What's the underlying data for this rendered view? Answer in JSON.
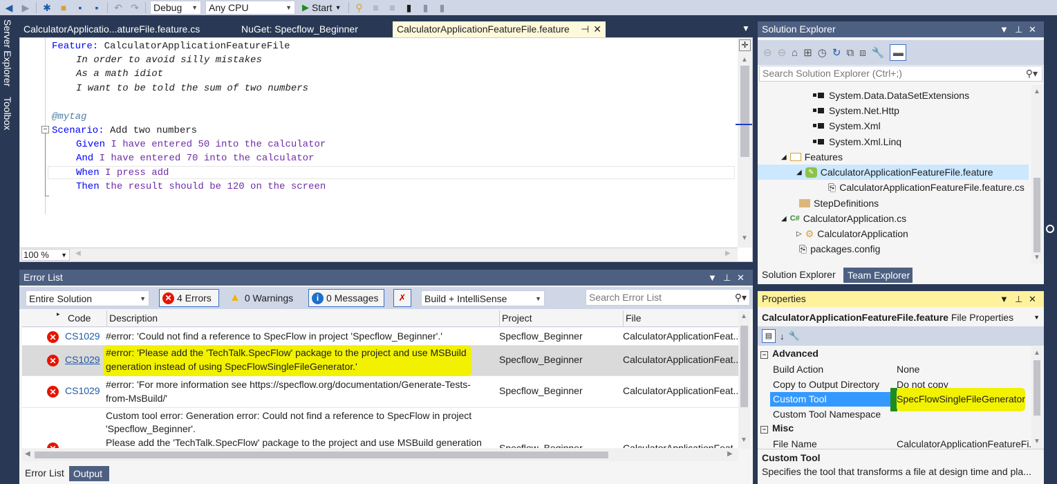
{
  "toolbar": {
    "config": "Debug",
    "platform": "Any CPU",
    "start_label": "Start"
  },
  "left_strip": {
    "server_explorer": "Server Explorer",
    "toolbox": "Toolbox"
  },
  "tabs": [
    {
      "label": "CalculatorApplicatio...atureFile.feature.cs"
    },
    {
      "label": "NuGet: Specflow_Beginner"
    },
    {
      "label": "CalculatorApplicationFeatureFile.feature"
    }
  ],
  "editor": {
    "lines": {
      "l1_kw": "Feature:",
      "l1_text": " CalculatorApplicationFeatureFile",
      "l2": "In order to avoid silly mistakes",
      "l3": "As a math idiot",
      "l4": "I want to be told the sum of two numbers",
      "l5": "@mytag",
      "l6_kw": "Scenario:",
      "l6_text": " Add two numbers",
      "l7_kw": "Given",
      "l7_text": " I have entered 50 into the calculator",
      "l8_kw": "And",
      "l8_text": " I have entered 70 into the calculator",
      "l9_kw": "When",
      "l9_text": " I press add",
      "l10_kw": "Then",
      "l10_text": " the result should be 120 on the screen"
    },
    "zoom": "100 %"
  },
  "solution_explorer": {
    "title": "Solution Explorer",
    "search_placeholder": "Search Solution Explorer (Ctrl+;)",
    "items": [
      {
        "label": "System.Data.DataSetExtensions"
      },
      {
        "label": "System.Net.Http"
      },
      {
        "label": "System.Xml"
      },
      {
        "label": "System.Xml.Linq"
      },
      {
        "label": "Features"
      },
      {
        "label": "CalculatorApplicationFeatureFile.feature"
      },
      {
        "label": "CalculatorApplicationFeatureFile.feature.cs"
      },
      {
        "label": "StepDefinitions"
      },
      {
        "label": "CalculatorApplication.cs"
      },
      {
        "label": "CalculatorApplication"
      },
      {
        "label": "packages.config"
      }
    ],
    "tab_solution": "Solution Explorer",
    "tab_team": "Team Explorer",
    "csharp_glyph": "C#"
  },
  "error_list": {
    "title": "Error List",
    "scope": "Entire Solution",
    "errors_btn": "4 Errors",
    "warnings_btn": "0 Warnings",
    "messages_btn": "0 Messages",
    "build_filter": "Build + IntelliSense",
    "search_placeholder": "Search Error List",
    "columns": {
      "code": "Code",
      "description": "Description",
      "project": "Project",
      "file": "File"
    },
    "rows": [
      {
        "code": "CS1029",
        "desc1": "#error: 'Could not find a reference to SpecFlow in project 'Specflow_Beginner'.'",
        "desc2": "",
        "project": "Specflow_Beginner",
        "file": "CalculatorApplicationFeat..."
      },
      {
        "code": "CS1029",
        "desc1": "#error: 'Please add the 'TechTalk.SpecFlow' package to the project and use MSBuild",
        "desc2": "generation instead of using SpecFlowSingleFileGenerator.'",
        "project": "Specflow_Beginner",
        "file": "CalculatorApplicationFeat..."
      },
      {
        "code": "CS1029",
        "desc1": "#error: 'For more information see https://specflow.org/documentation/Generate-Tests-",
        "desc2": "from-MsBuild/'",
        "project": "Specflow_Beginner",
        "file": "CalculatorApplicationFeat..."
      },
      {
        "code": "",
        "desc1": "Custom tool error: Generation error: Could not find a reference to SpecFlow in project",
        "desc2": "'Specflow_Beginner'.",
        "desc3": "Please add the 'TechTalk.SpecFlow' package to the project and use MSBuild generation",
        "project": "Specflow_Beginner",
        "file": "CalculatorApplicationFeat..."
      }
    ],
    "bottom_tab_errors": "Error List",
    "bottom_tab_output": "Output"
  },
  "properties": {
    "title": "Properties",
    "object_name": "CalculatorApplicationFeatureFile.feature",
    "object_type": " File Properties",
    "section_advanced": "Advanced",
    "section_misc": "Misc",
    "rows": [
      {
        "name": "Build Action",
        "value": "None"
      },
      {
        "name": "Copy to Output Directory",
        "value": "Do not copy"
      },
      {
        "name": "Custom Tool",
        "value": "SpecFlowSingleFileGenerator"
      },
      {
        "name": "Custom Tool Namespace",
        "value": ""
      },
      {
        "name": "File Name",
        "value": "CalculatorApplicationFeatureFi..."
      }
    ],
    "desc_title": "Custom Tool",
    "desc_text": "Specifies the tool that transforms a file at design time and pla..."
  },
  "colors": {
    "accent": "#007acc",
    "highlight": "#f2f200",
    "error": "#e51400"
  }
}
